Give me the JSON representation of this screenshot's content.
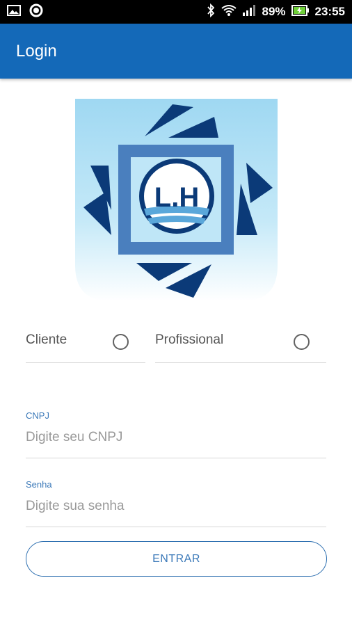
{
  "status_bar": {
    "battery": "89%",
    "time": "23:55",
    "icons": [
      "gallery-icon",
      "circle-notification-icon",
      "bluetooth-icon",
      "wifi-icon",
      "signal-icon",
      "battery-charging-icon"
    ]
  },
  "app_bar": {
    "title": "Login"
  },
  "logo": {
    "text": "L.H",
    "bg_color": "#a9dcf5",
    "primary": "#0b3a78",
    "accent": "#3b73b5"
  },
  "account_type": {
    "options": [
      {
        "label": "Cliente",
        "selected": false
      },
      {
        "label": "Profissional",
        "selected": false
      }
    ]
  },
  "fields": {
    "cnpj": {
      "label": "CNPJ",
      "placeholder": "Digite seu CNPJ",
      "value": ""
    },
    "senha": {
      "label": "Senha",
      "placeholder": "Digite sua senha",
      "value": ""
    }
  },
  "submit": {
    "label": "ENTRAR"
  },
  "colors": {
    "primary": "#1469b8",
    "label_blue": "#3a78b8",
    "divider": "#d6d6d6"
  }
}
